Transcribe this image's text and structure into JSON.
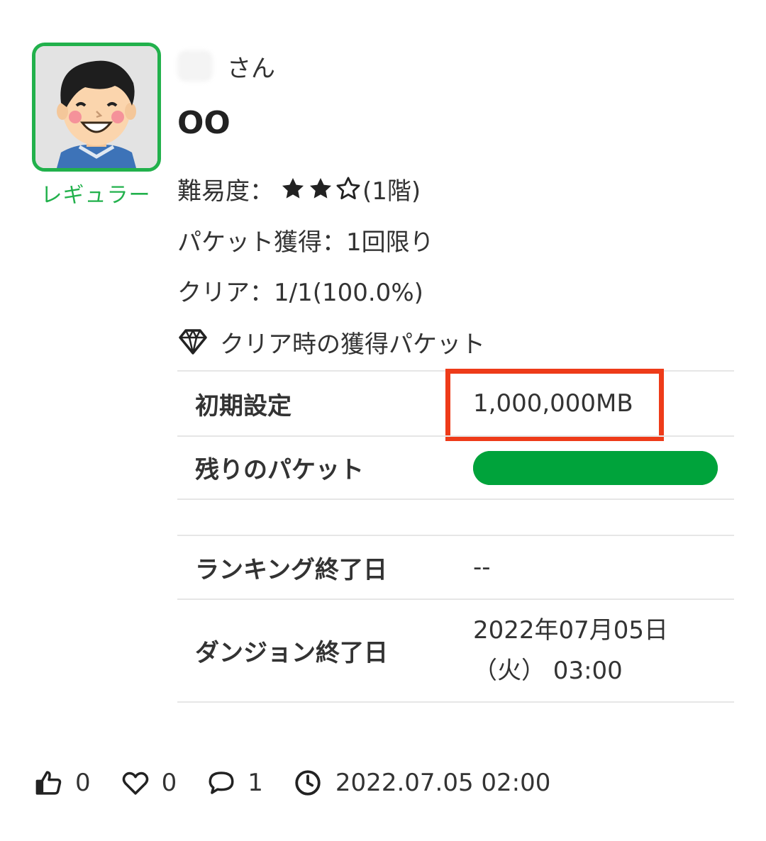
{
  "user": {
    "rank_label": "レギュラー",
    "name_suffix": "さん"
  },
  "dungeon": {
    "title": "OO",
    "difficulty_label": "難易度：",
    "difficulty_stars_filled": 2,
    "difficulty_stars_total": 3,
    "difficulty_floor": "(1階)",
    "packet_acquire": "パケット獲得：1回限り",
    "clear": "クリア：1/1(100.0%)",
    "clear_packets_heading": "クリア時の獲得パケット"
  },
  "table": {
    "initial_label": "初期設定",
    "initial_value": "1,000,000MB",
    "remaining_label": "残りのパケット",
    "remaining_fraction": 1.0,
    "ranking_end_label": "ランキング終了日",
    "ranking_end_value": "--",
    "dungeon_end_label": "ダンジョン終了日",
    "dungeon_end_value_line1": "2022年07月05日",
    "dungeon_end_value_line2": "（火） 03:00"
  },
  "footer": {
    "likes": "0",
    "favorites": "0",
    "comments": "1",
    "posted_at": "2022.07.05 02:00"
  },
  "colors": {
    "accent_green": "#22b14c",
    "bar_green": "#00a33b",
    "highlight_red": "#ee3b19"
  }
}
